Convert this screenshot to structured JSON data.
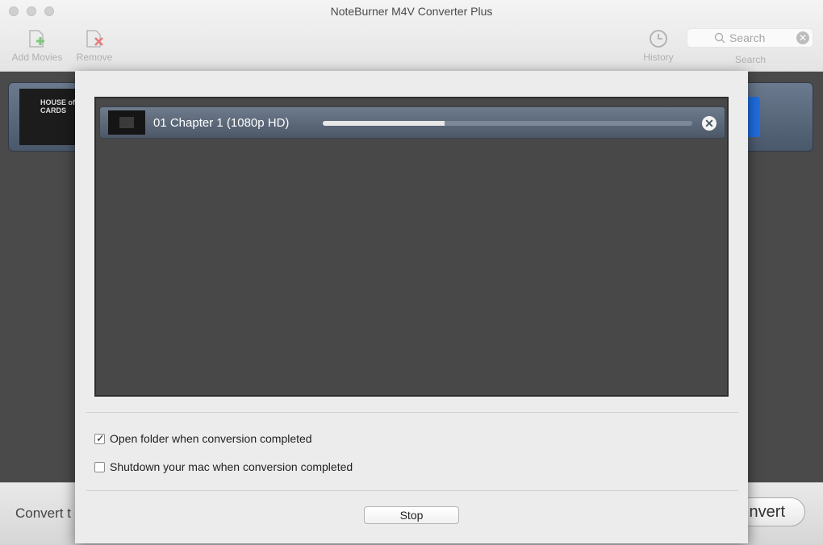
{
  "window": {
    "title": "NoteBurner M4V Converter Plus"
  },
  "toolbar": {
    "add_movies": {
      "label": "Add Movies",
      "icon": "add-movies-icon"
    },
    "remove": {
      "label": "Remove",
      "icon": "remove-icon"
    },
    "history": {
      "label": "History",
      "icon": "history-icon"
    },
    "search": {
      "placeholder": "Search",
      "label": "Search"
    }
  },
  "background": {
    "movie_thumb_text": "HOUSE of CARDS",
    "convert_to_label": "Convert t",
    "convert_button": "nvert"
  },
  "dialog": {
    "items": [
      {
        "title": "01 Chapter 1 (1080p HD)",
        "progress": 0.33
      }
    ],
    "options": {
      "open_folder": {
        "label": "Open folder when conversion completed",
        "checked": true
      },
      "shutdown": {
        "label": "Shutdown your mac when conversion completed",
        "checked": false
      }
    },
    "stop_button": "Stop"
  },
  "colors": {
    "row_bg": "#5d6a7c",
    "progress_fill": "#e8e8e8",
    "list_bg": "#484848"
  }
}
